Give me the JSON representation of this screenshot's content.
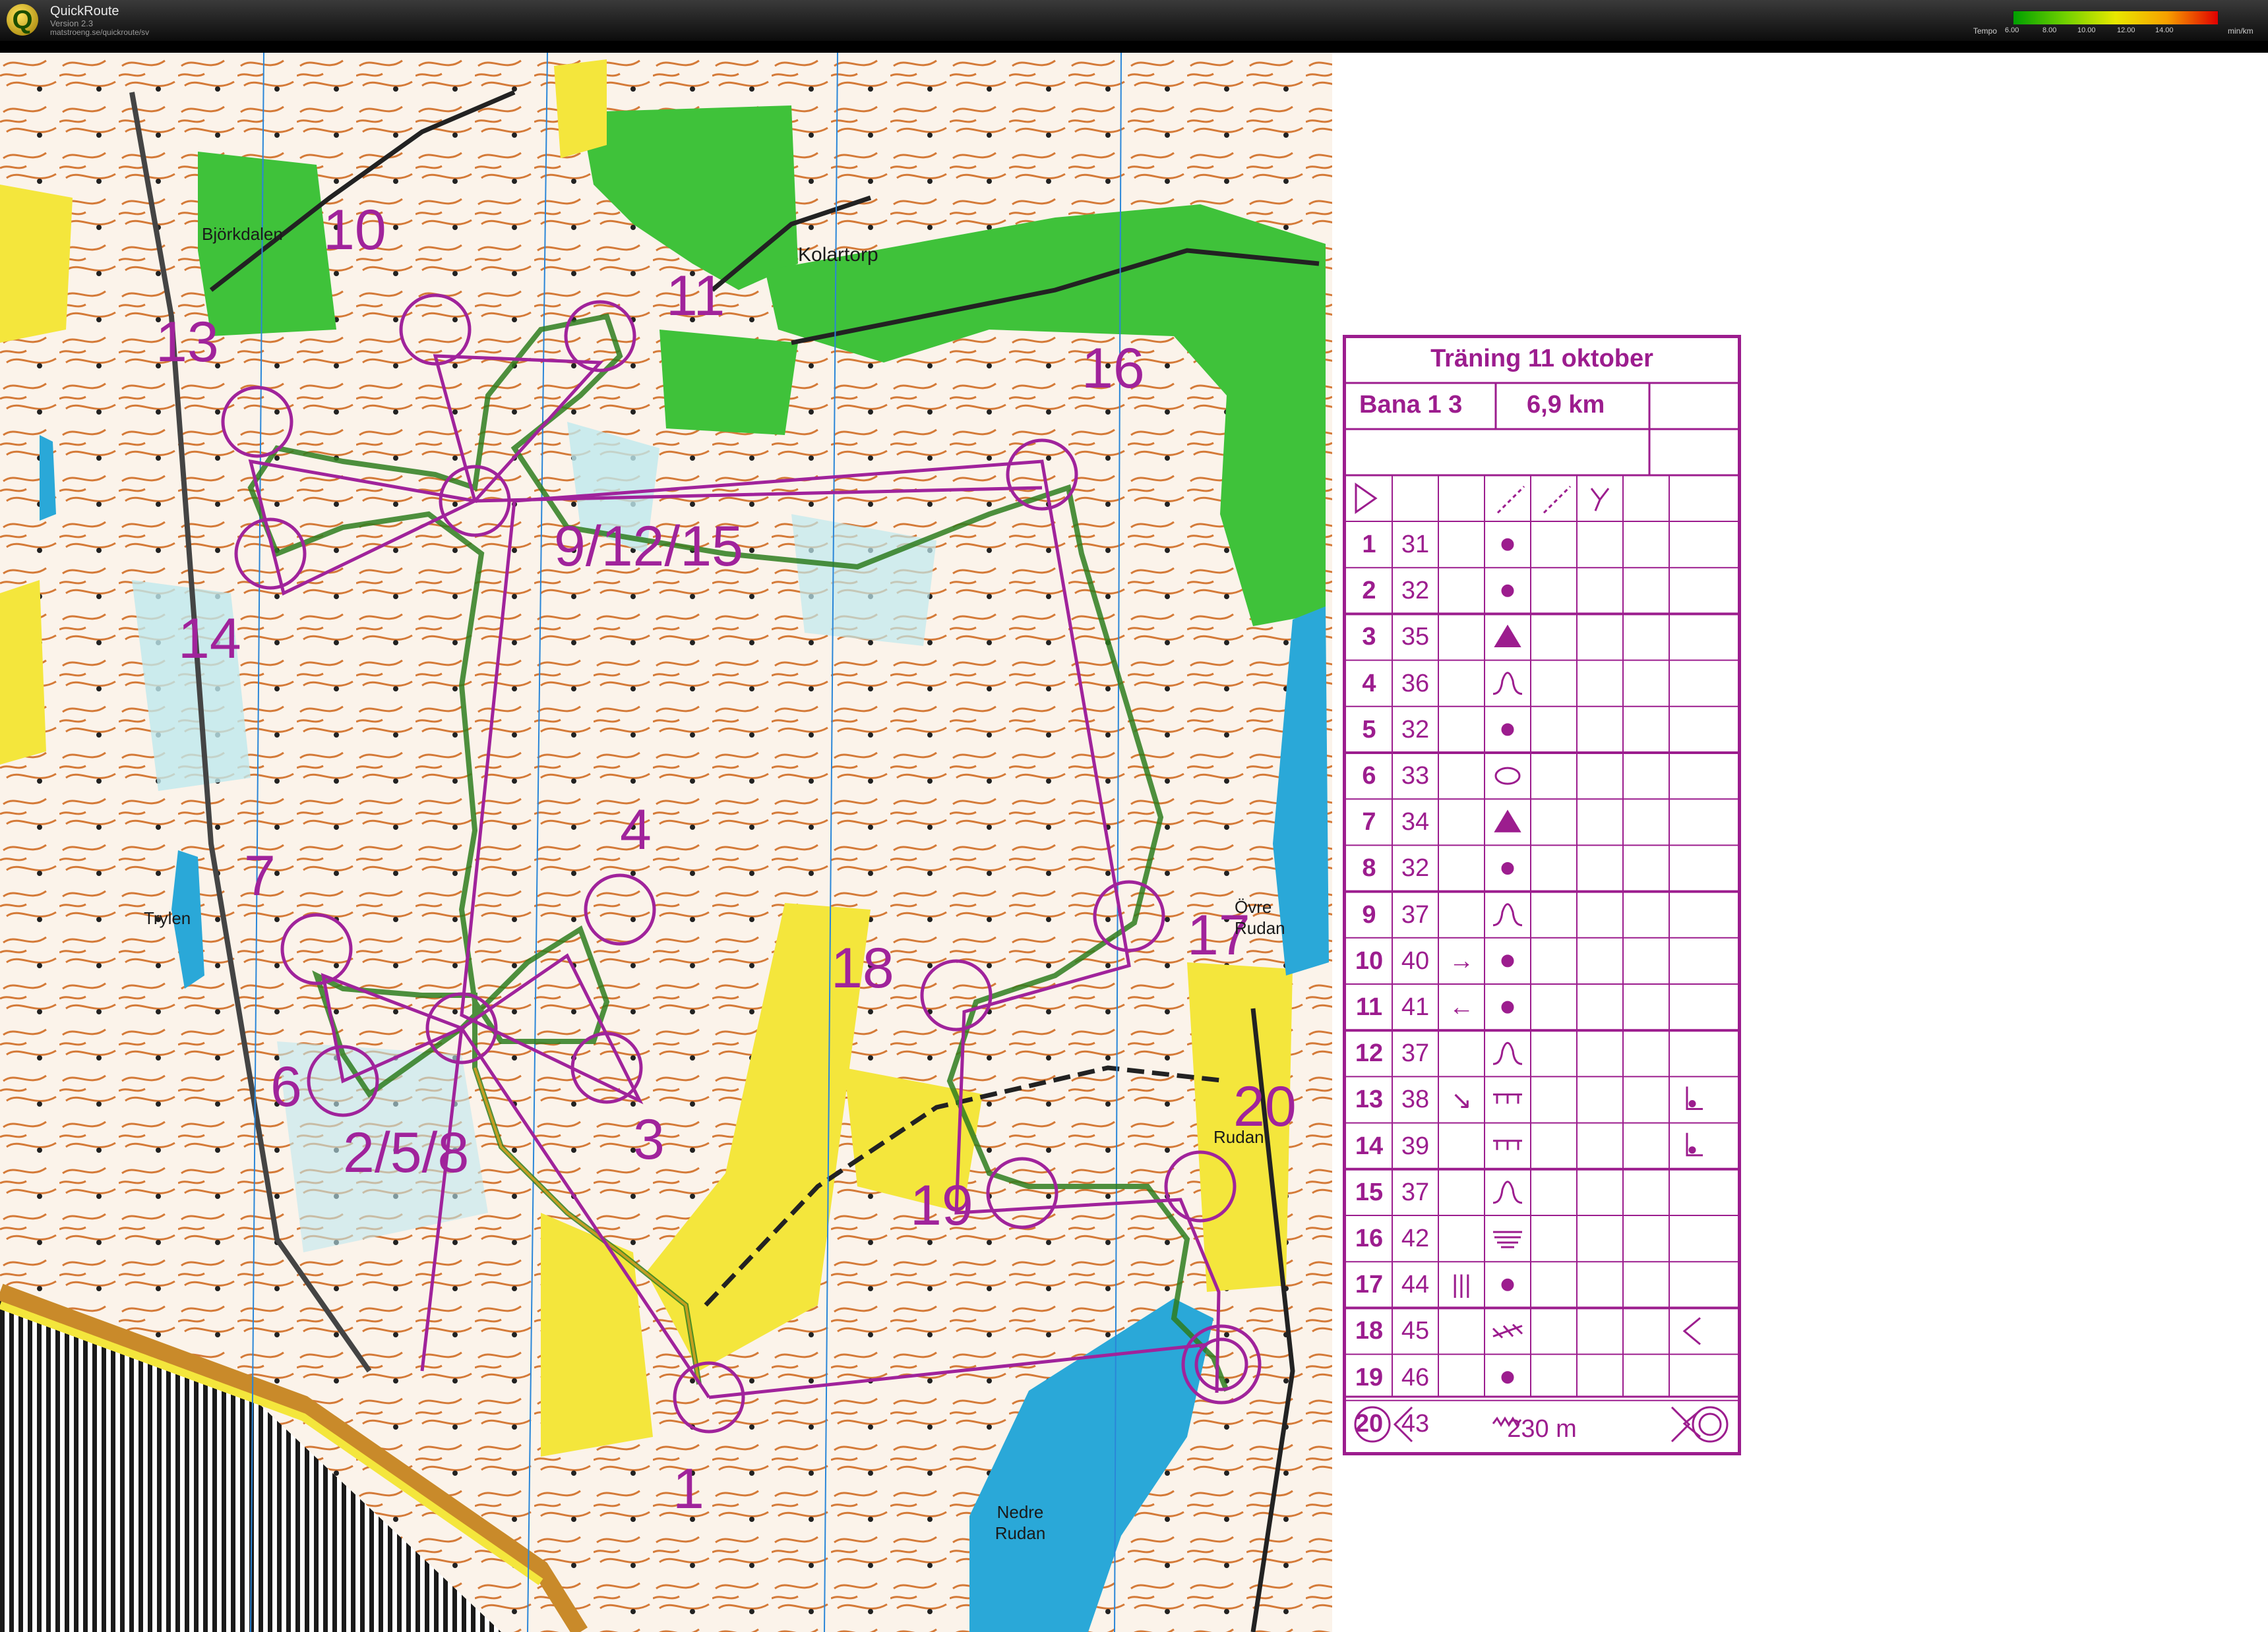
{
  "app": {
    "title": "QuickRoute",
    "version": "Version 2.3",
    "url": "matstroeng.se/quickroute/sv"
  },
  "tempo_legend": {
    "label": "Tempo",
    "ticks": [
      "6.00",
      "8.00",
      "10.00",
      "12.00",
      "14.00"
    ],
    "unit": "min/km"
  },
  "control_card": {
    "title": "Träning 11 oktober",
    "course": "Bana 1 3",
    "length": "6,9 km",
    "rows": [
      {
        "num": "1",
        "code": "31",
        "dir": "",
        "feature": "dot",
        "extra": ""
      },
      {
        "num": "2",
        "code": "32",
        "dir": "",
        "feature": "dot",
        "extra": ""
      },
      {
        "num": "3",
        "code": "35",
        "dir": "",
        "feature": "triangle",
        "extra": ""
      },
      {
        "num": "4",
        "code": "36",
        "dir": "",
        "feature": "knoll",
        "extra": ""
      },
      {
        "num": "5",
        "code": "32",
        "dir": "",
        "feature": "dot",
        "extra": ""
      },
      {
        "num": "6",
        "code": "33",
        "dir": "",
        "feature": "oval",
        "extra": ""
      },
      {
        "num": "7",
        "code": "34",
        "dir": "",
        "feature": "triangle",
        "extra": ""
      },
      {
        "num": "8",
        "code": "32",
        "dir": "",
        "feature": "dot",
        "extra": ""
      },
      {
        "num": "9",
        "code": "37",
        "dir": "",
        "feature": "knoll",
        "extra": ""
      },
      {
        "num": "10",
        "code": "40",
        "dir": "→",
        "feature": "dot",
        "extra": ""
      },
      {
        "num": "11",
        "code": "41",
        "dir": "←",
        "feature": "dot",
        "extra": ""
      },
      {
        "num": "12",
        "code": "37",
        "dir": "",
        "feature": "knoll",
        "extra": ""
      },
      {
        "num": "13",
        "code": "38",
        "dir": "↘",
        "feature": "cliff",
        "extra": "foot"
      },
      {
        "num": "14",
        "code": "39",
        "dir": "",
        "feature": "cliff",
        "extra": "foot"
      },
      {
        "num": "15",
        "code": "37",
        "dir": "",
        "feature": "knoll",
        "extra": ""
      },
      {
        "num": "16",
        "code": "42",
        "dir": "",
        "feature": "terrace",
        "extra": ""
      },
      {
        "num": "17",
        "code": "44",
        "dir": "|||",
        "feature": "dot",
        "extra": ""
      },
      {
        "num": "18",
        "code": "45",
        "dir": "",
        "feature": "rough",
        "extra": "corner"
      },
      {
        "num": "19",
        "code": "46",
        "dir": "",
        "feature": "dot",
        "extra": ""
      },
      {
        "num": "20",
        "code": "43",
        "dir": "",
        "feature": "zigzag",
        "extra": "corner"
      }
    ],
    "finish_distance": "230 m"
  },
  "control_labels": [
    "10",
    "11",
    "13",
    "16",
    "9/12/15",
    "14",
    "7",
    "4",
    "18",
    "17",
    "6",
    "2/5/8",
    "3",
    "19",
    "20",
    "1"
  ],
  "place_names": [
    "Björkdalen",
    "Kolartorp",
    "Trylen",
    "Övre Rudan",
    "Rudan",
    "Nedre Rudan"
  ],
  "colors": {
    "course": "#a0239b",
    "water": "#2aa8d8",
    "field": "#f4e63c",
    "green": "#3fc23a",
    "contour": "#d2691e"
  }
}
